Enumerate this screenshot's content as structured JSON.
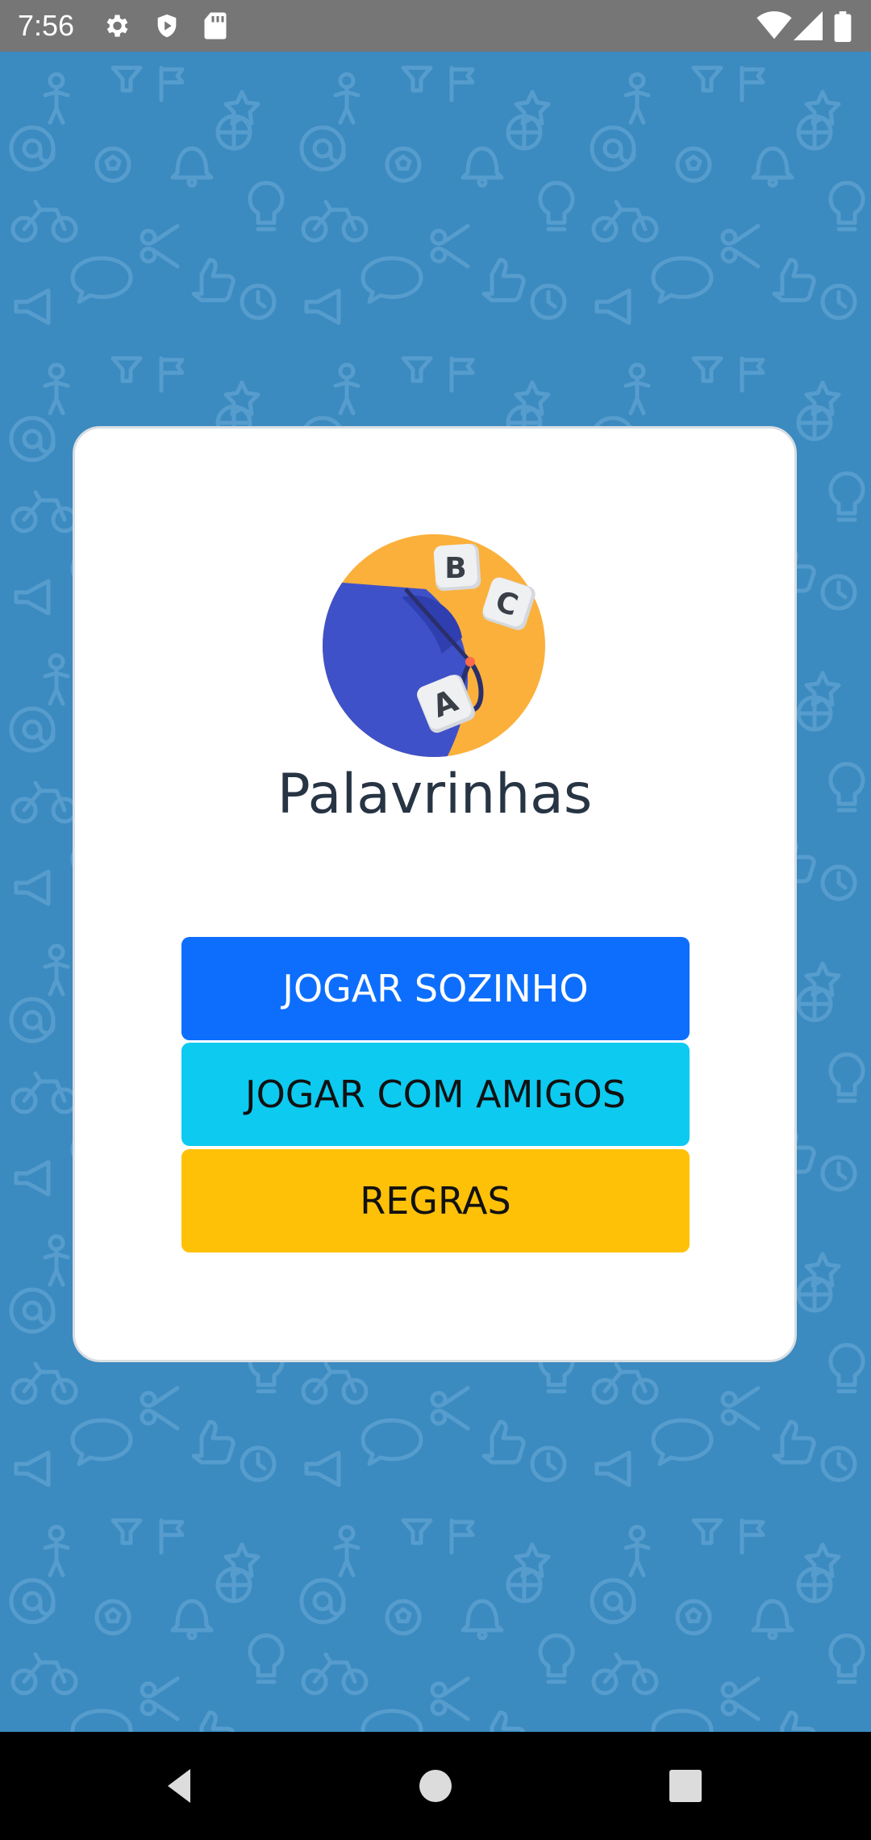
{
  "status_bar": {
    "time": "7:56",
    "icons": [
      "gear-icon",
      "shield-play-icon",
      "sd-card-icon",
      "wifi-icon",
      "signal-icon",
      "battery-icon"
    ]
  },
  "background": {
    "color": "#3b8ac0",
    "pattern_icons": [
      "at-icon",
      "soccer-ball-icon",
      "bell-icon",
      "bicycle-icon",
      "scissors-icon",
      "peace-hand-icon",
      "basketball-icon",
      "speech-bubble-icon",
      "thumbs-up-icon",
      "star-icon",
      "lightbulb-icon",
      "flag-icon",
      "person-icon",
      "megaphone-icon",
      "clock-icon",
      "eye-icon",
      "funnel-icon",
      "compass-icon"
    ]
  },
  "app": {
    "title": "Palavrinhas",
    "logo": {
      "name": "word-bag-logo",
      "tiles": [
        "B",
        "C",
        "A"
      ]
    }
  },
  "buttons": {
    "solo": "JOGAR SOZINHO",
    "friends": "JOGAR COM AMIGOS",
    "rules": "REGRAS"
  },
  "colors": {
    "primary": "#0d6efd",
    "info": "#0dcaf0",
    "warning": "#ffc107",
    "card_bg": "#ffffff",
    "title_text": "#273444"
  },
  "nav_bar": {
    "icons": [
      "back-icon",
      "home-icon",
      "recents-icon"
    ]
  }
}
